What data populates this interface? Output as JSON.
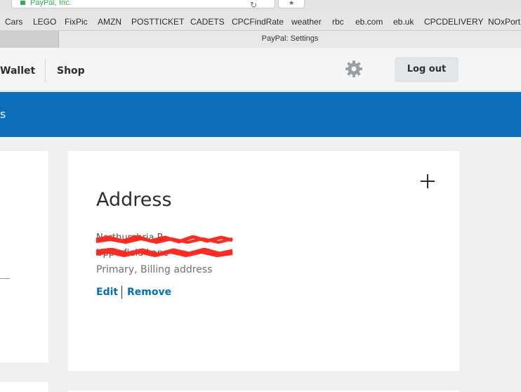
{
  "browser": {
    "url_text": "PayPal, Inc.",
    "tab_title": "PayPal: Settings",
    "bookmarks": [
      "Cars",
      "LEGO",
      "FixPic",
      "AMZN",
      "POSTTICKET",
      "CADETS",
      "CPCFindRate",
      "weather",
      "rbc",
      "eb.com",
      "eb.uk",
      "CPCDELIVERY",
      "NOxPort"
    ]
  },
  "header": {
    "nav_wallet": "Wallet",
    "nav_shop": "Shop",
    "logout_label": "Log out",
    "settings_icon": "gear-icon"
  },
  "band": {
    "title_fragment": "s"
  },
  "address_card": {
    "title": "Address",
    "line1": "Northumbria P",
    "line2": "Upperfield Lane",
    "type": "Primary, Billing address",
    "edit_label": "Edit",
    "remove_label": "Remove",
    "add_icon": "plus-icon"
  },
  "colors": {
    "brand_blue": "#0c6dba",
    "link_blue": "#0070ba",
    "redaction_red": "#ff2a1f"
  }
}
